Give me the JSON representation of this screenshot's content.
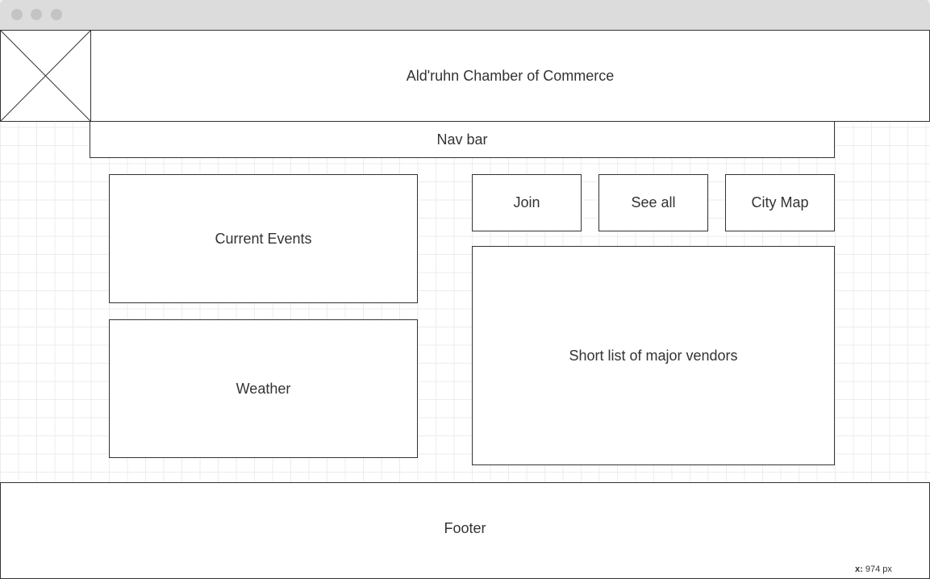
{
  "window": {
    "controls": [
      "close-dot",
      "minimize-dot",
      "maximize-dot"
    ]
  },
  "header": {
    "logo_icon": "image-placeholder-icon",
    "title": "Ald'ruhn Chamber of Commerce"
  },
  "nav": {
    "label": "Nav bar"
  },
  "main": {
    "current_events": "Current Events",
    "weather": "Weather",
    "buttons": {
      "join": "Join",
      "see_all": "See all",
      "city_map": "City Map"
    },
    "vendors": "Short list of major vendors"
  },
  "footer": {
    "label": "Footer"
  },
  "coordinate_readout": {
    "axis_label": "x:",
    "value": "974",
    "unit": "px"
  },
  "colors": {
    "stroke": "#333333",
    "grid": "#ececec",
    "titlebar": "#dcdcdc"
  }
}
